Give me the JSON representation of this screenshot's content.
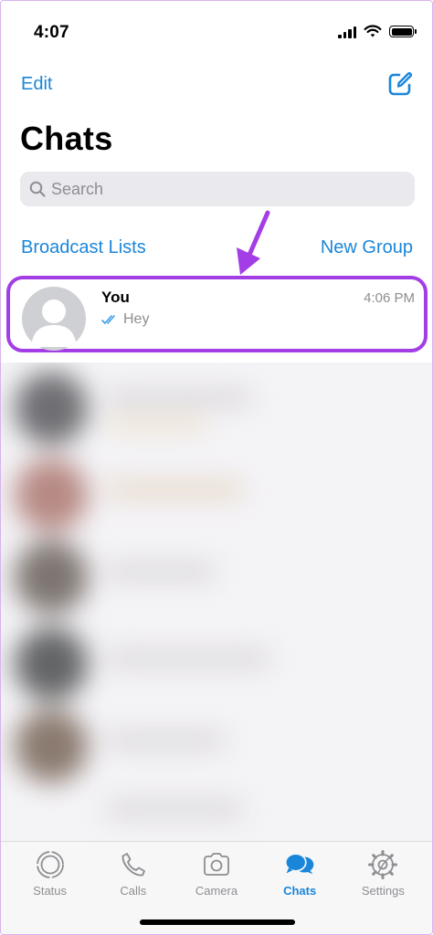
{
  "status_bar": {
    "time": "4:07"
  },
  "header": {
    "edit_label": "Edit",
    "title": "Chats",
    "compose_icon": "compose-icon"
  },
  "search": {
    "placeholder": "Search"
  },
  "links": {
    "broadcast_label": "Broadcast Lists",
    "new_group_label": "New Group"
  },
  "chat": {
    "name": "You",
    "time": "4:06 PM",
    "preview": "Hey",
    "read_receipt_icon": "double-check-icon"
  },
  "colors": {
    "accent": "#1a86d9",
    "highlight": "#a33ee6"
  },
  "tabs": [
    {
      "label": "Status",
      "icon": "status-icon"
    },
    {
      "label": "Calls",
      "icon": "phone-icon"
    },
    {
      "label": "Camera",
      "icon": "camera-icon"
    },
    {
      "label": "Chats",
      "icon": "chats-icon",
      "active": true
    },
    {
      "label": "Settings",
      "icon": "gear-icon"
    }
  ]
}
